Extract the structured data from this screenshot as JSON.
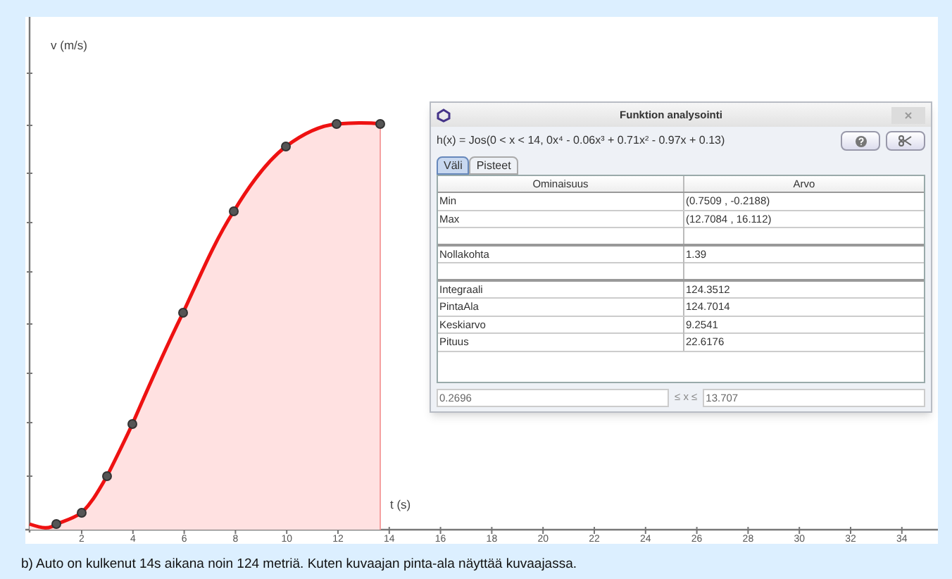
{
  "graph": {
    "y_axis_label": "v (m/s)",
    "x_axis_label": "t (s)",
    "x_tick_labels": [
      "2",
      "4",
      "6",
      "8",
      "10",
      "12",
      "14",
      "16",
      "18",
      "20",
      "22",
      "24",
      "26",
      "28",
      "30",
      "32",
      "34"
    ]
  },
  "dialog": {
    "title": "Funktion analysointi",
    "formula": "h(x) = Jos(0 < x < 14, 0x⁴ - 0.06x³ + 0.71x² - 0.97x + 0.13)",
    "tabs": [
      {
        "label": "Väli",
        "selected": true
      },
      {
        "label": "Pisteet",
        "selected": false
      }
    ],
    "columns": [
      "Ominaisuus",
      "Arvo"
    ],
    "rows": [
      {
        "kind": "value",
        "name": "Min",
        "value": "(0.7509 , -0.2188)"
      },
      {
        "kind": "value",
        "name": "Max",
        "value": "(12.7084 , 16.112)"
      },
      {
        "kind": "blank"
      },
      {
        "kind": "value",
        "name": "Nollakohta",
        "value": "1.39"
      },
      {
        "kind": "blank"
      },
      {
        "kind": "value",
        "name": "Integraali",
        "value": "124.3512"
      },
      {
        "kind": "value",
        "name": "PintaAla",
        "value": "124.7014"
      },
      {
        "kind": "value",
        "name": "Keskiarvo",
        "value": "9.2541"
      },
      {
        "kind": "value",
        "name": "Pituus",
        "value": "22.6176"
      }
    ],
    "interval": {
      "from": "0.2696",
      "relation": "≤ x ≤",
      "to": "13.707"
    }
  },
  "caption": "b) Auto on kulkenut 14s aikana noin 124 metriä. Kuten kuvaajan pinta-ala näyttää kuvaajassa."
}
